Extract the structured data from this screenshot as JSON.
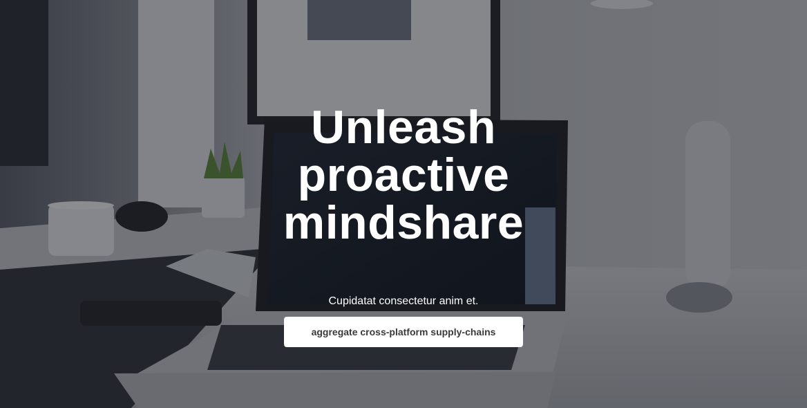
{
  "hero": {
    "headline_lines": [
      "Unleash",
      "proactive",
      "mindshare"
    ],
    "subheading": "Cupidatat consectetur anim et.",
    "cta_label": "aggregate cross-platform supply-chains",
    "overlay_color": "#141820",
    "text_color": "#ffffff",
    "button_background": "#ffffff",
    "button_text_color": "#3a3a3a"
  }
}
